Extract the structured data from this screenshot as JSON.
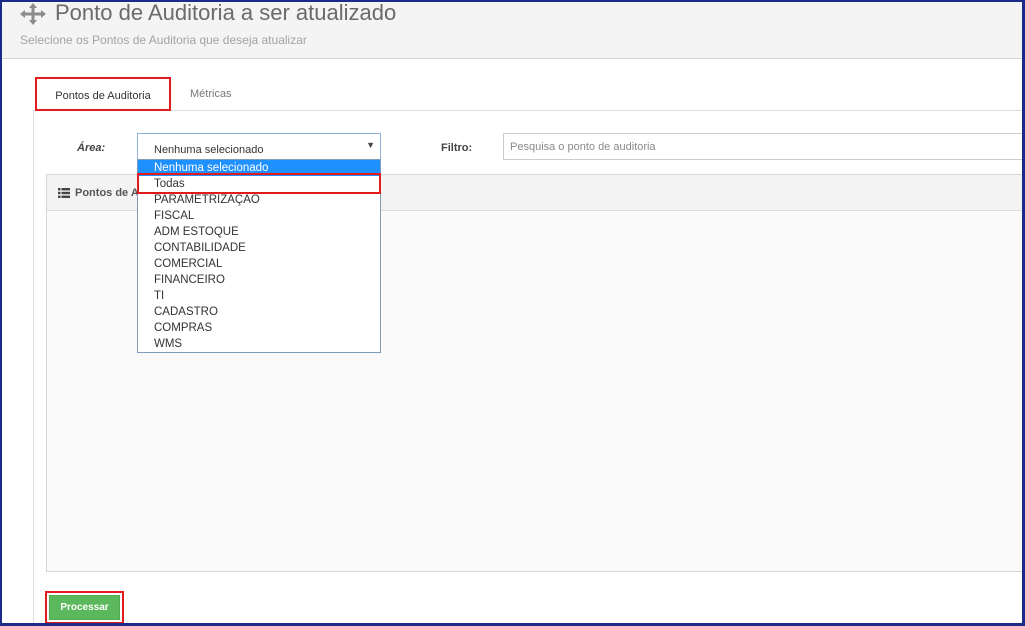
{
  "header": {
    "title": "Ponto de Auditoria a ser atualizado",
    "subtitle": "Selecione os Pontos de Auditoria que deseja atualizar",
    "icon": "move-icon"
  },
  "tabs": [
    {
      "label": "Pontos de Auditoria",
      "active": true
    },
    {
      "label": "Métricas",
      "active": false
    }
  ],
  "form": {
    "area_label": "Área:",
    "area_selected": "Nenhuma selecionado",
    "filter_label": "Filtro:",
    "filter_placeholder": "Pesquisa o ponto de auditoria",
    "filter_value": ""
  },
  "dropdown": {
    "options": [
      "Nenhuma selecionado",
      "Todas",
      "PARAMETRIZAÇÃO",
      "FISCAL",
      "ADM ESTOQUE",
      "CONTABILIDADE",
      "COMERCIAL",
      "FINANCEIRO",
      "TI",
      "CADASTRO",
      "COMPRAS",
      "WMS"
    ],
    "selected_index": 0,
    "highlighted_index": 1
  },
  "list": {
    "title": "Pontos de A",
    "icon": "list-icon"
  },
  "actions": {
    "process_label": "Processar"
  },
  "colors": {
    "highlight": "#e51a1a",
    "selected_option": "#1e90ff",
    "process_button": "#5cb85c",
    "frame": "#1c2a8a"
  }
}
